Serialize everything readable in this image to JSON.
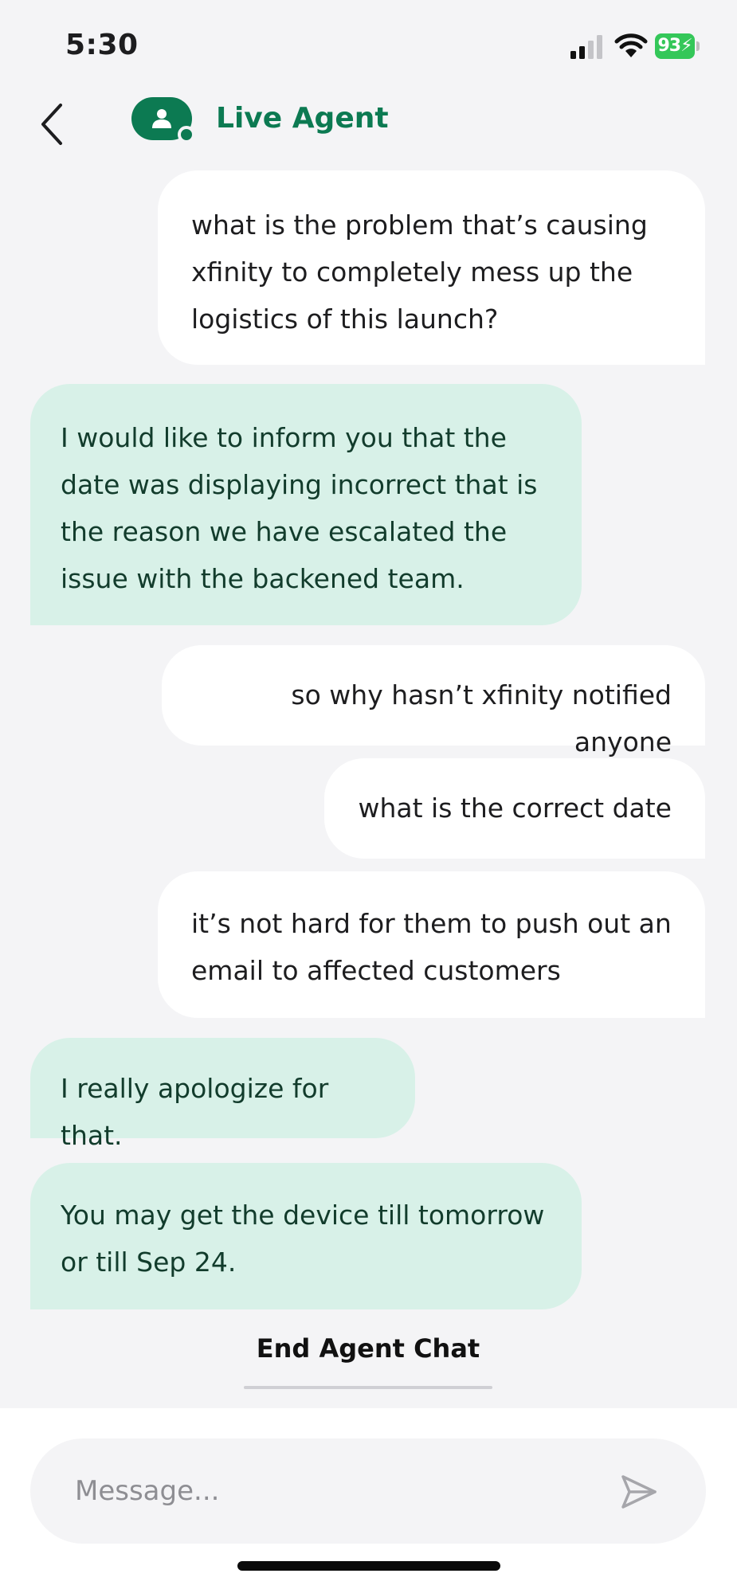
{
  "status_bar": {
    "time": "5:30",
    "battery": "93"
  },
  "header": {
    "agent_name": "Live Agent"
  },
  "messages": [
    {
      "sender": "user",
      "text": "what is the problem that’s causing xfinity to completely mess up the logistics of this launch?"
    },
    {
      "sender": "agent",
      "text": "I would like to inform you that the date was displaying incorrect that is the reason we have escalated the issue with the backened team."
    },
    {
      "sender": "user",
      "text": "so why hasn’t xfinity notified anyone"
    },
    {
      "sender": "user",
      "text": "what is the correct date"
    },
    {
      "sender": "user",
      "text": "it’s not hard for them to push out an email to affected customers"
    },
    {
      "sender": "agent",
      "text": "I really apologize for that."
    },
    {
      "sender": "agent",
      "text": "You may get the device till tomorrow or till Sep 24."
    }
  ],
  "end_chat_label": "End Agent Chat",
  "composer": {
    "placeholder": "Message..."
  },
  "colors": {
    "brand_green": "#0c7a52",
    "agent_bubble": "#d8f1e8",
    "user_bubble": "#ffffff",
    "background": "#f4f4f6",
    "battery_green": "#34c759"
  },
  "icons": [
    "signal-icon",
    "wifi-icon",
    "battery-icon",
    "back-chevron-icon",
    "person-icon",
    "send-icon"
  ]
}
